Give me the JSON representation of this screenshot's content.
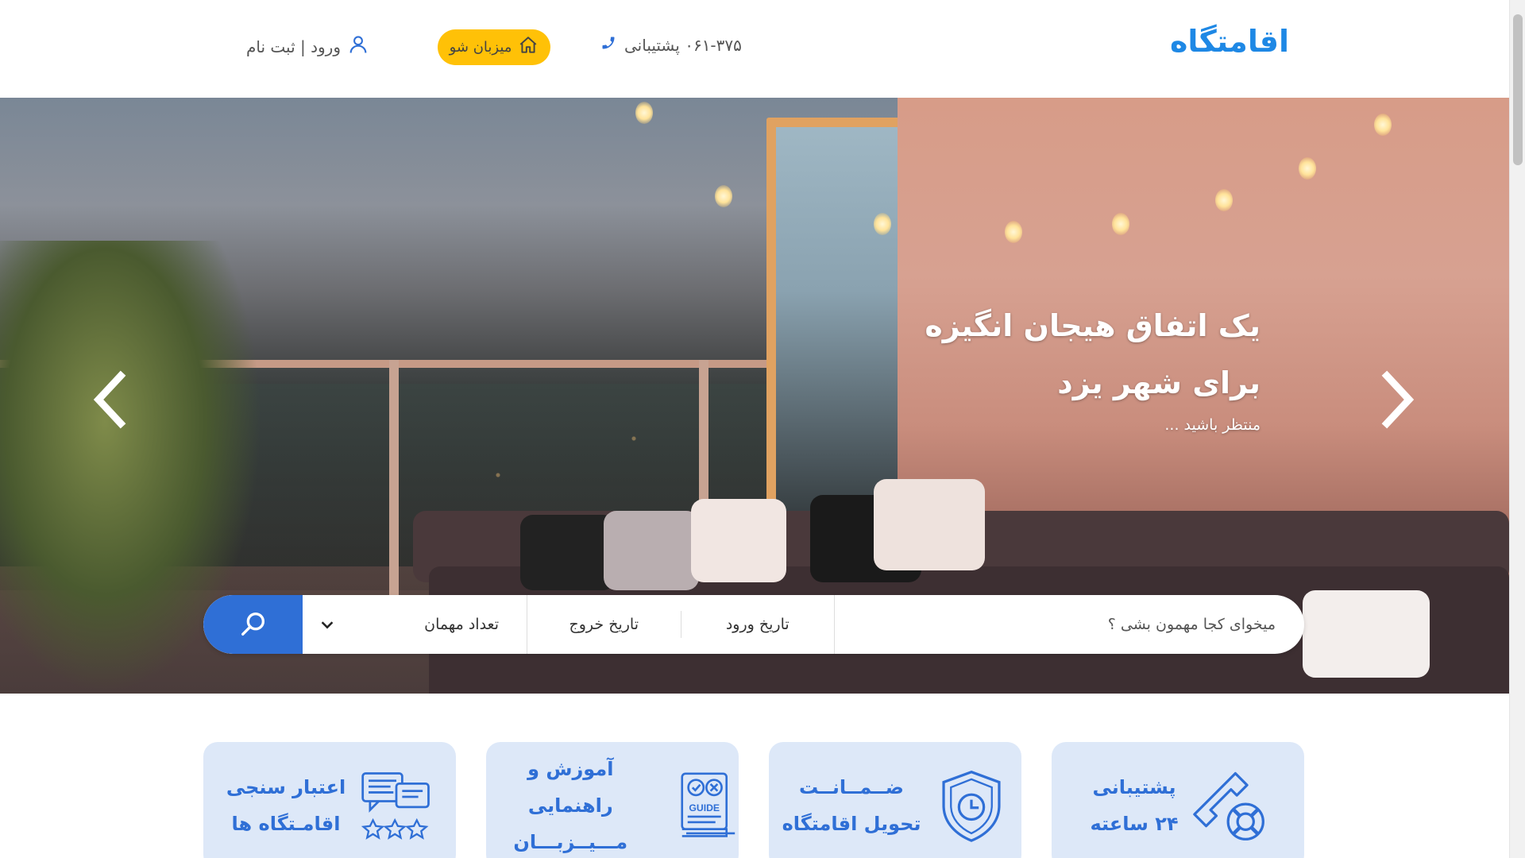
{
  "header": {
    "logo": "اقامتگاه",
    "support_text": "۰۶۱-۳۷۵ پشتیبانی",
    "host_button": "میزبان شو",
    "login_text": "ورود | ثبت نام"
  },
  "hero": {
    "title_line1": "یک اتفاق هیجان انگیزه",
    "title_line2": "برای شهر یزد",
    "subtitle": "منتظر باشید ..."
  },
  "search": {
    "destination_placeholder": "میخوای کجا مهمون بشی ؟",
    "checkin_label": "تاریخ ورود",
    "checkout_label": "تاریخ خروج",
    "guests_label": "تعداد مهمان"
  },
  "features": [
    {
      "line1": "پشتیبانی",
      "line2": "۲۴ ساعته",
      "icon": "support-phone-icon"
    },
    {
      "line1": "ضــمــانــت",
      "line2": "تحویل اقامتگاه",
      "icon": "shield-clock-icon"
    },
    {
      "line1": "آموزش و راهنمایی",
      "line2": "مـــیــزبـــان",
      "icon": "guide-book-icon"
    },
    {
      "line1": "اعتبار سنجی",
      "line2": "اقامـتگاه ها",
      "icon": "rating-chat-icon"
    }
  ],
  "colors": {
    "brand_blue": "#1e88e5",
    "search_blue": "#2f6fd6",
    "host_yellow": "#ffc107",
    "card_bg": "#dde8f8"
  }
}
